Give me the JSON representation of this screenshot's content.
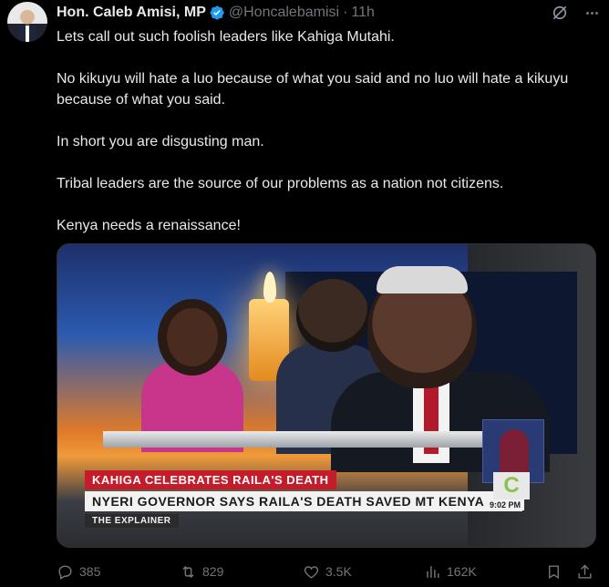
{
  "post": {
    "author_name": "Hon. Caleb Amisi, MP",
    "handle": "@Honcalebamisi",
    "separator": "·",
    "time": "11h",
    "paragraphs": [
      "Lets call out such foolish leaders like Kahiga Mutahi.",
      "No kikuyu will hate a luo because of what you said and no luo will hate a kikuyu because of what you said.",
      "In short you are disgusting man.",
      "Tribal leaders are the source of our problems as a nation not citizens.",
      "Kenya needs a renaissance!"
    ]
  },
  "media": {
    "kicker": "KAHIGA CELEBRATES RAILA'S DEATH",
    "headline": "NYERI GOVERNOR SAYS RAILA'S DEATH SAVED MT KENYA",
    "segment": "THE EXPLAINER",
    "clock": "9:02 PM",
    "logo": "C"
  },
  "actions": {
    "replies": "385",
    "reposts": "829",
    "likes": "3.5K",
    "views": "162K"
  },
  "icons": {
    "verified": "verified-badge-icon",
    "grok": "grok-icon",
    "more": "more-icon",
    "reply": "reply-icon",
    "repost": "repost-icon",
    "like": "heart-icon",
    "views": "views-icon",
    "bookmark": "bookmark-icon",
    "share": "share-icon"
  },
  "colors": {
    "background": "#000000",
    "text": "#e7e9ea",
    "muted": "#71767b",
    "verified": "#1d9bf0"
  }
}
